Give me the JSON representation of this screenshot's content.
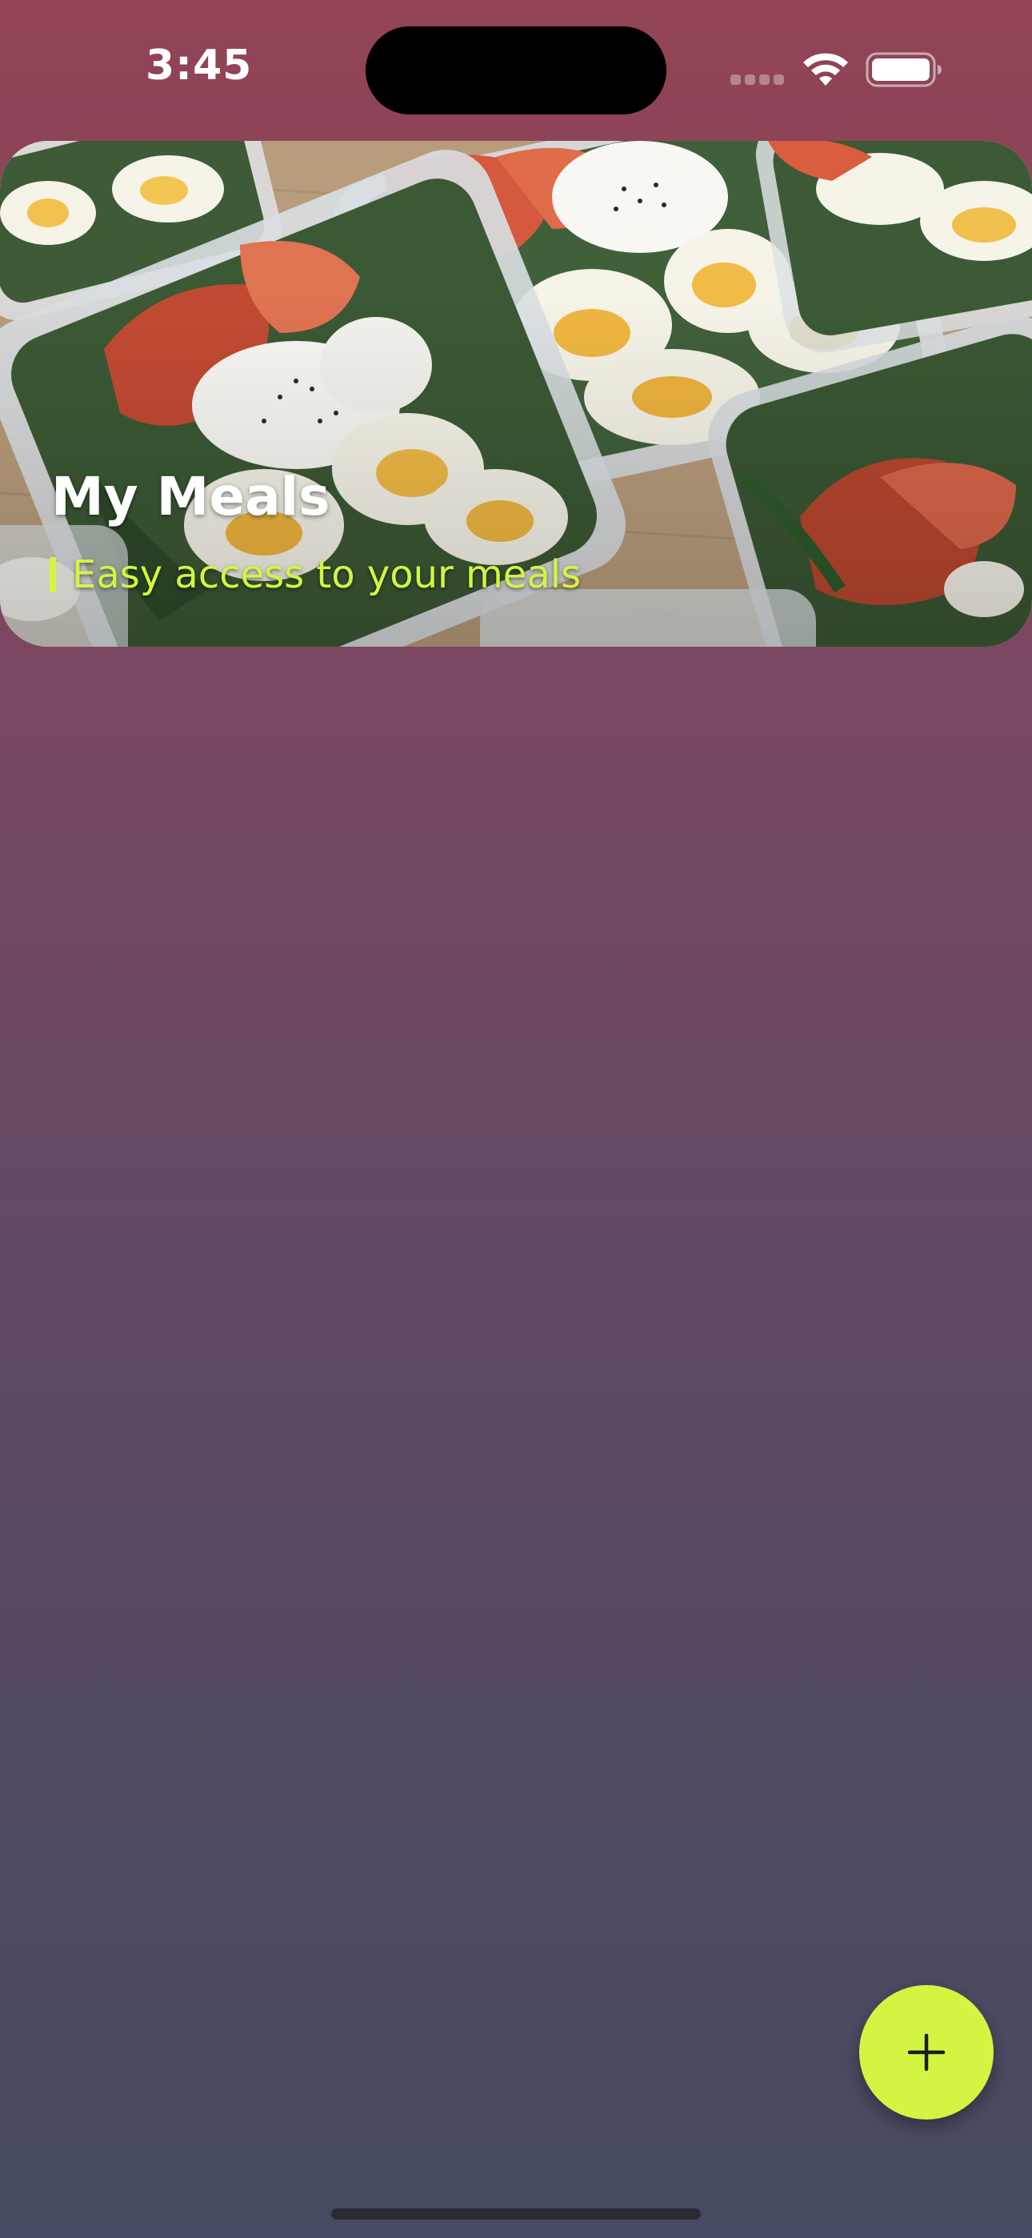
{
  "status_bar": {
    "time": "3:45",
    "icons": [
      "cellular-signal-icon",
      "wifi-icon",
      "battery-icon"
    ]
  },
  "hero": {
    "image": "meal-prep-containers-photo",
    "title": "My Meals",
    "subtitle": "Easy access to your meals"
  },
  "fab": {
    "icon": "plus-icon"
  },
  "colors": {
    "accent": "#d3f542",
    "background_top": "#924454",
    "background_bottom": "#454b62"
  }
}
